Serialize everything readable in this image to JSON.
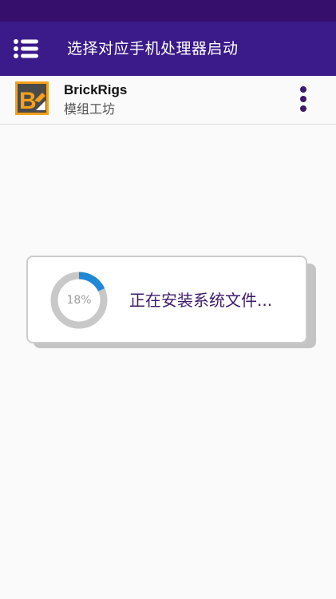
{
  "header": {
    "title": "选择对应手机处理器启动",
    "menu_icon": "menu-list-icon",
    "background": "#3b1a8a",
    "status_bar_color": "#350f6b"
  },
  "app": {
    "name": "BrickRigs",
    "subtitle": "模组工坊",
    "logo_icon": "brickrigs-logo",
    "more_icon": "more-vertical-icon"
  },
  "dialog": {
    "progress_text": "18%",
    "progress_value": 0.18,
    "message": "正在安装系统文件...",
    "progress_color": "#1e88d6",
    "track_color": "#c8c8c8",
    "message_color": "#3d1b6e"
  }
}
